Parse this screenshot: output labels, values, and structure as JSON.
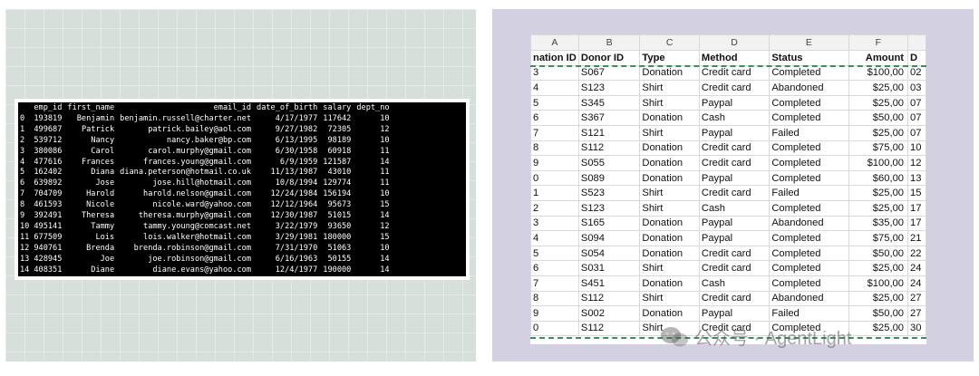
{
  "dataframe": {
    "columns": [
      "",
      "emp_id",
      "first_name",
      "email_id",
      "date_of_birth",
      "salary",
      "dept_no"
    ],
    "rows": [
      [
        "0",
        "193819",
        "Benjamin",
        "benjamin.russell@charter.net",
        "4/17/1977",
        "117642",
        "10"
      ],
      [
        "1",
        "499687",
        "Patrick",
        "patrick.bailey@aol.com",
        "9/27/1982",
        "72305",
        "12"
      ],
      [
        "2",
        "539712",
        "Nancy",
        "nancy.baker@bp.com",
        "6/13/1995",
        "98189",
        "10"
      ],
      [
        "3",
        "380086",
        "Carol",
        "carol.murphy@gmail.com",
        "6/30/1958",
        "60918",
        "11"
      ],
      [
        "4",
        "477616",
        "Frances",
        "frances.young@gmail.com",
        "6/9/1959",
        "121587",
        "14"
      ],
      [
        "5",
        "162402",
        "Diana",
        "diana.peterson@hotmail.co.uk",
        "11/13/1987",
        "43010",
        "11"
      ],
      [
        "6",
        "639892",
        "Jose",
        "jose.hill@hotmail.com",
        "10/8/1994",
        "129774",
        "11"
      ],
      [
        "7",
        "704709",
        "Harold",
        "harold.nelson@gmail.com",
        "12/24/1984",
        "156194",
        "10"
      ],
      [
        "8",
        "461593",
        "Nicole",
        "nicole.ward@yahoo.com",
        "12/12/1964",
        "95673",
        "15"
      ],
      [
        "9",
        "392491",
        "Theresa",
        "theresa.murphy@gmail.com",
        "12/30/1987",
        "51015",
        "14"
      ],
      [
        "10",
        "495141",
        "Tammy",
        "tammy.young@comcast.net",
        "3/22/1979",
        "93650",
        "12"
      ],
      [
        "11",
        "677509",
        "Lois",
        "lois.walker@hotmail.com",
        "3/29/1981",
        "180000",
        "15"
      ],
      [
        "12",
        "940761",
        "Brenda",
        "brenda.robinson@gmail.com",
        "7/31/1970",
        "51063",
        "10"
      ],
      [
        "13",
        "428945",
        "Joe",
        "joe.robinson@gmail.com",
        "6/16/1963",
        "50155",
        "14"
      ],
      [
        "14",
        "408351",
        "Diane",
        "diane.evans@yahoo.com",
        "12/4/1977",
        "190000",
        "14"
      ]
    ]
  },
  "spreadsheet": {
    "column_letters": [
      "A",
      "B",
      "C",
      "D",
      "E",
      "F",
      ""
    ],
    "headers": [
      "nation ID",
      "Donor ID",
      "Type",
      "Method",
      "Status",
      "Amount",
      "D"
    ],
    "rows": [
      [
        "3",
        "S067",
        "Donation",
        "Credit card",
        "Completed",
        "$100,00",
        "02"
      ],
      [
        "4",
        "S123",
        "Shirt",
        "Credit card",
        "Abandoned",
        "$25,00",
        "03"
      ],
      [
        "5",
        "S345",
        "Shirt",
        "Paypal",
        "Completed",
        "$25,00",
        "07"
      ],
      [
        "6",
        "S367",
        "Donation",
        "Cash",
        "Completed",
        "$50,00",
        "07"
      ],
      [
        "7",
        "S121",
        "Shirt",
        "Paypal",
        "Failed",
        "$25,00",
        "07"
      ],
      [
        "8",
        "S112",
        "Donation",
        "Credit card",
        "Completed",
        "$75,00",
        "10"
      ],
      [
        "9",
        "S055",
        "Donation",
        "Credit card",
        "Completed",
        "$100,00",
        "12"
      ],
      [
        "0",
        "S089",
        "Donation",
        "Paypal",
        "Completed",
        "$60,00",
        "13"
      ],
      [
        "1",
        "S523",
        "Shirt",
        "Credit card",
        "Failed",
        "$25,00",
        "15"
      ],
      [
        "2",
        "S123",
        "Shirt",
        "Cash",
        "Completed",
        "$25,00",
        "17"
      ],
      [
        "3",
        "S165",
        "Donation",
        "Paypal",
        "Abandoned",
        "$35,00",
        "17"
      ],
      [
        "4",
        "S094",
        "Donation",
        "Paypal",
        "Completed",
        "$75,00",
        "21"
      ],
      [
        "5",
        "S054",
        "Donation",
        "Credit card",
        "Completed",
        "$50,00",
        "22"
      ],
      [
        "6",
        "S031",
        "Shirt",
        "Credit card",
        "Completed",
        "$25,00",
        "24"
      ],
      [
        "7",
        "S451",
        "Donation",
        "Cash",
        "Completed",
        "$100,00",
        "24"
      ],
      [
        "8",
        "S112",
        "Shirt",
        "Credit card",
        "Abandoned",
        "$25,00",
        "27"
      ],
      [
        "9",
        "S002",
        "Donation",
        "Paypal",
        "Failed",
        "$50,00",
        "27"
      ],
      [
        "0",
        "S112",
        "Shirt",
        "Credit card",
        "Completed",
        "$25,00",
        "30"
      ]
    ]
  },
  "watermark": {
    "text": "公众号 · AgentLight",
    "icon": "wechat-icon"
  },
  "colors": {
    "left_bg": "#d6dfd9",
    "right_bg": "#d3d1e1",
    "marquee": "#3c8d5c"
  }
}
